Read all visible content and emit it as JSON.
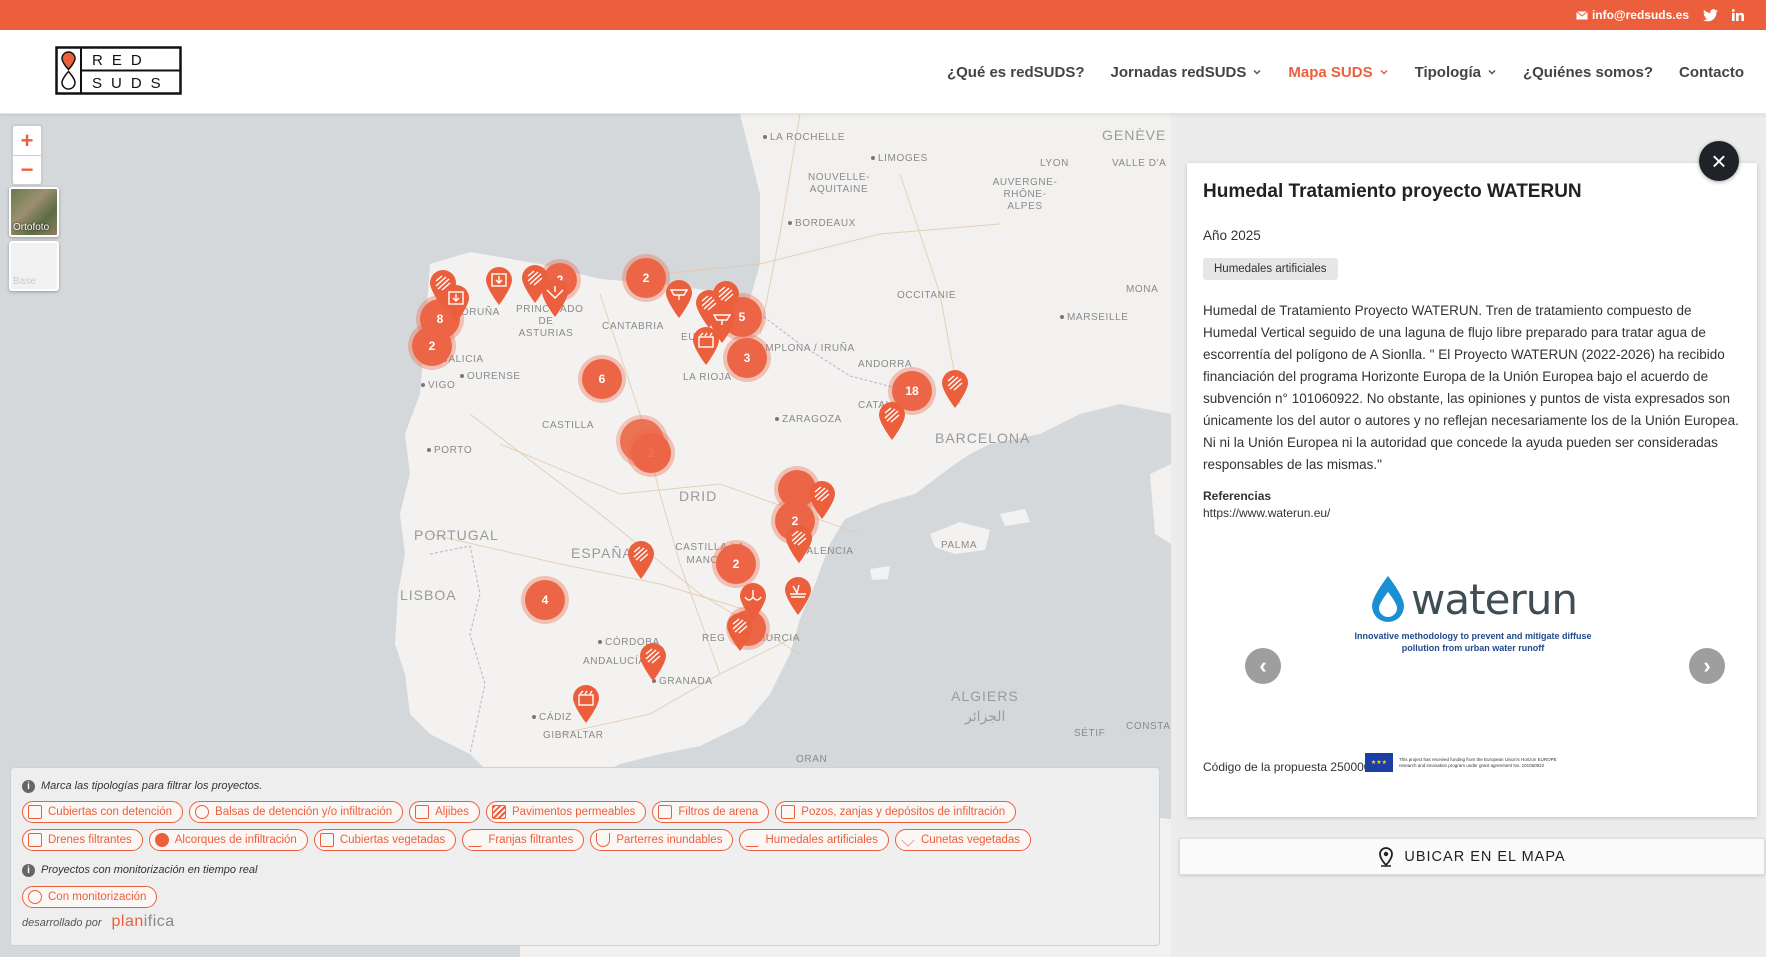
{
  "topbar": {
    "email": "info@redsuds.es",
    "social": [
      "twitter-icon",
      "linkedin-icon"
    ]
  },
  "logo": {
    "line1": "RED",
    "line2": "SUDS"
  },
  "nav": [
    {
      "label": "¿Qué es redSUDS?",
      "dropdown": false,
      "active": false
    },
    {
      "label": "Jornadas redSUDS",
      "dropdown": true,
      "active": false
    },
    {
      "label": "Mapa SUDS",
      "dropdown": true,
      "active": true
    },
    {
      "label": "Tipología",
      "dropdown": true,
      "active": false
    },
    {
      "label": "¿Quiénes somos?",
      "dropdown": false,
      "active": false
    },
    {
      "label": "Contacto",
      "dropdown": false,
      "active": false
    }
  ],
  "map": {
    "zoom_in": "+",
    "zoom_out": "−",
    "layers": [
      "Ortofoto",
      "Base"
    ],
    "labels": [
      "LA ROCHELLE",
      "LIMOGES",
      "GENÈVE",
      "VALLE D'A",
      "LYON",
      "NOUVELLE-AQUITAINE",
      "AUVERGNE-RHÔNE-ALPES",
      "BORDEAUX",
      "OCCITANIE",
      "MONA",
      "MARSEILLE",
      "CORUÑA",
      "PRINCIPADO DE ASTURIAS",
      "CANTABRIA",
      "EUSK",
      "AMPLONA / IRUÑA",
      "GALICIA",
      "OURENSE",
      "VIGO",
      "LA RIOJA",
      "ANDORRA",
      "CASTILLA",
      "ZARAGOZA",
      "CATALUÑA",
      "BARCELONA",
      "PORTO",
      "DRID",
      "PORTUGAL",
      "ESPAÑA",
      "CASTILLA-LA MANCHA",
      "LISBOA",
      "VALENCIA",
      "PALMA",
      "CÓRDOBA",
      "ANDALUCÍA",
      "GRANADA",
      "REG",
      "MURCIA",
      "CÁDIZ",
      "GIBRALTAR",
      "ALGIERS",
      "الجزائر",
      "ORAN",
      "SÉTIF",
      "CONSTA"
    ],
    "clusters": [
      "8",
      "2",
      "2",
      "2",
      "5",
      "3",
      "6",
      "2",
      "18",
      "4",
      "2",
      "2"
    ]
  },
  "legend": {
    "hint_typologies": "Marca las tipologías para filtrar los proyectos.",
    "typologies": [
      "Cubiertas con detención",
      "Balsas de detención y/o infiltración",
      "Aljibes",
      "Pavimentos permeables",
      "Filtros de arena",
      "Pozos, zanjas y depósitos de infiltración",
      "Drenes filtrantes",
      "Alcorques de infiltración",
      "Cubiertas vegetadas",
      "Franjas filtrantes",
      "Parterres inundables",
      "Humedales artificiales",
      "Cunetas vegetadas"
    ],
    "hint_monitoring": "Proyectos con monitorización en tiempo real",
    "monitoring": "Con monitorización",
    "developed_by": "desarrollado por",
    "developer_a": "plan",
    "developer_b": "ifica"
  },
  "panel": {
    "title": "Humedal Tratamiento proyecto WATERUN",
    "year": "Año 2025",
    "tag": "Humedales artificiales",
    "description": "Humedal de Tratamiento Proyecto WATERUN. Tren de tratamiento compuesto de Humedal Vertical seguido de una laguna de flujo libre preparado para tratar agua de escorrentía del polígono de A Sionlla. \" El Proyecto WATERUN (2022-2026) ha recibido financiación del programa Horizonte Europa de la Unión Europea bajo el acuerdo de subvención n° 101060922. No obstante, las opiniones y puntos de vista expresados son únicamente los del autor o autores y no reflejan necesariamente los de la Unión Europea. Ni ni la Unión Europea ni la autoridad que concede la ayuda pueden ser consideradas responsables de las mismas.\"",
    "references_label": "Referencias",
    "reference_url": "https://www.waterun.eu/",
    "image_logo_text": "waterun",
    "image_subtitle": "Innovative methodology to prevent and mitigate diffuse pollution from urban water runoff",
    "image_eu_text": "This project has received funding from the European Union's Horizon EUROPE research and innovation program under grant agreement No. 101060922",
    "proposal_code": "Código de la propuesta 2500007",
    "close": "×",
    "locate_button": "UBICAR EN EL MAPA"
  },
  "colors": {
    "accent": "#ec5f3d",
    "dark": "#1f2226"
  }
}
